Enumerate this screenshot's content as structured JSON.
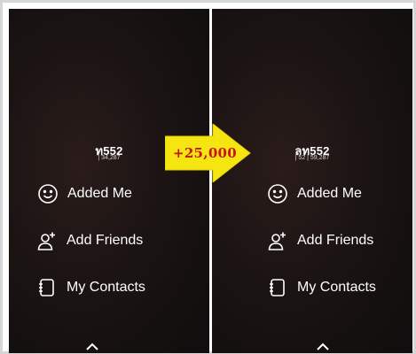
{
  "panels": [
    {
      "username": "ท552",
      "score": "| 34,287",
      "menu": [
        {
          "label": "Added Me",
          "icon": "smiley-icon"
        },
        {
          "label": "Add Friends",
          "icon": "add-friend-icon"
        },
        {
          "label": "My Contacts",
          "icon": "contacts-book-icon"
        }
      ]
    },
    {
      "username": "ลท552",
      "score": "| 52 | 59,287",
      "menu": [
        {
          "label": "Added Me",
          "icon": "smiley-icon"
        },
        {
          "label": "Add Friends",
          "icon": "add-friend-icon"
        },
        {
          "label": "My Contacts",
          "icon": "contacts-book-icon"
        }
      ]
    }
  ],
  "callout": {
    "text": "+25,000",
    "arrow_color": "#f5e612",
    "text_color": "#c81414"
  },
  "colors": {
    "background": "#161111",
    "text": "#ffffff"
  }
}
